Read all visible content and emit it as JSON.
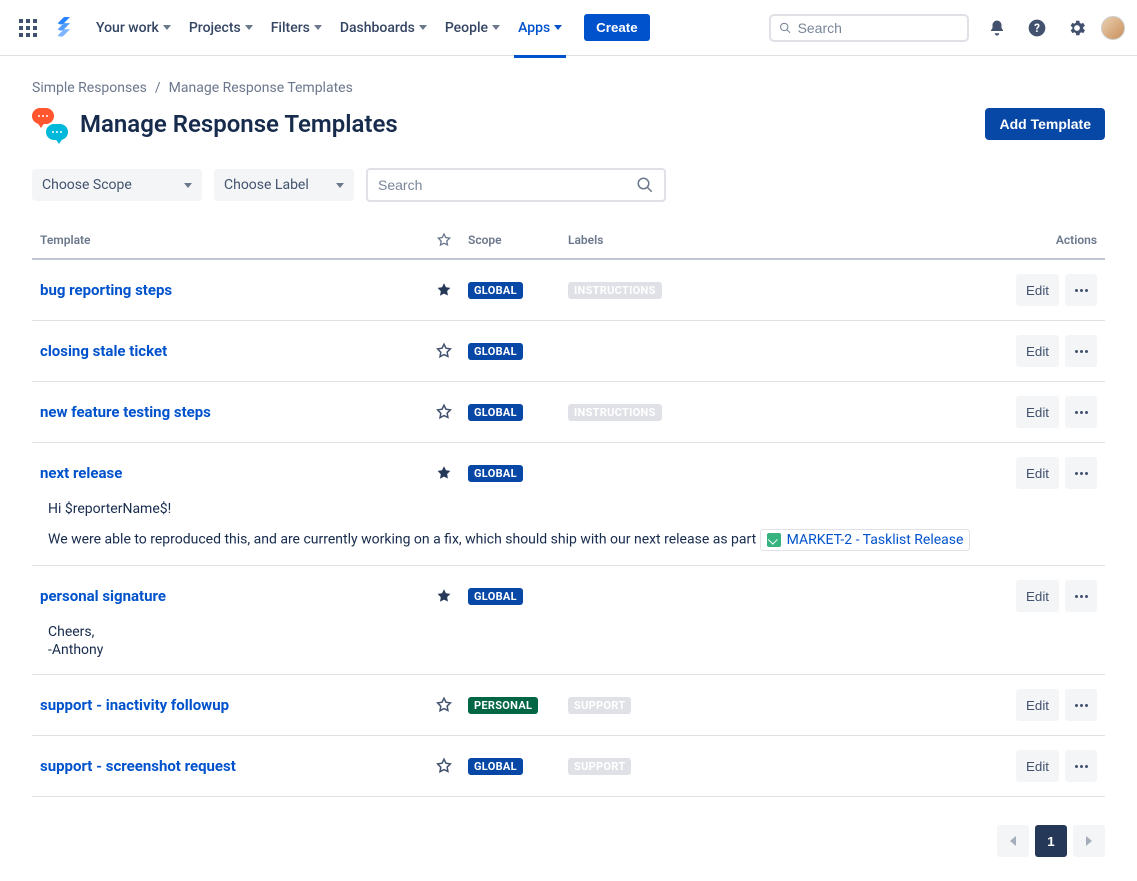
{
  "nav": {
    "items": [
      {
        "label": "Your work"
      },
      {
        "label": "Projects"
      },
      {
        "label": "Filters"
      },
      {
        "label": "Dashboards"
      },
      {
        "label": "People"
      },
      {
        "label": "Apps"
      }
    ],
    "create_label": "Create",
    "search_placeholder": "Search"
  },
  "breadcrumbs": {
    "root": "Simple Responses",
    "current": "Manage Response Templates"
  },
  "page": {
    "title": "Manage Response Templates",
    "add_template_label": "Add Template"
  },
  "filters": {
    "scope_placeholder": "Choose Scope",
    "label_placeholder": "Choose Label",
    "search_placeholder": "Search"
  },
  "table": {
    "headers": {
      "template": "Template",
      "scope": "Scope",
      "labels": "Labels",
      "actions": "Actions"
    },
    "edit_label": "Edit",
    "rows": [
      {
        "name": "bug reporting steps",
        "starred": true,
        "scope": "GLOBAL",
        "labels": [
          "INSTRUCTIONS"
        ]
      },
      {
        "name": "closing stale ticket",
        "starred": false,
        "scope": "GLOBAL",
        "labels": []
      },
      {
        "name": "new feature testing steps",
        "starred": false,
        "scope": "GLOBAL",
        "labels": [
          "INSTRUCTIONS"
        ]
      },
      {
        "name": "next release",
        "starred": true,
        "scope": "GLOBAL",
        "labels": [],
        "preview": {
          "greeting": "Hi $reporterName$!",
          "body": "We were able to reproduced this, and are currently working on a fix, which should ship with our next release as part",
          "issue_link": "MARKET-2 - Tasklist Release"
        }
      },
      {
        "name": "personal signature",
        "starred": true,
        "scope": "GLOBAL",
        "labels": [],
        "preview": {
          "lines": [
            "Cheers,",
            "-Anthony"
          ]
        }
      },
      {
        "name": "support - inactivity followup",
        "starred": false,
        "scope": "PERSONAL",
        "labels": [
          "SUPPORT"
        ]
      },
      {
        "name": "support - screenshot request",
        "starred": false,
        "scope": "GLOBAL",
        "labels": [
          "SUPPORT"
        ]
      }
    ]
  },
  "pagination": {
    "current": "1"
  }
}
